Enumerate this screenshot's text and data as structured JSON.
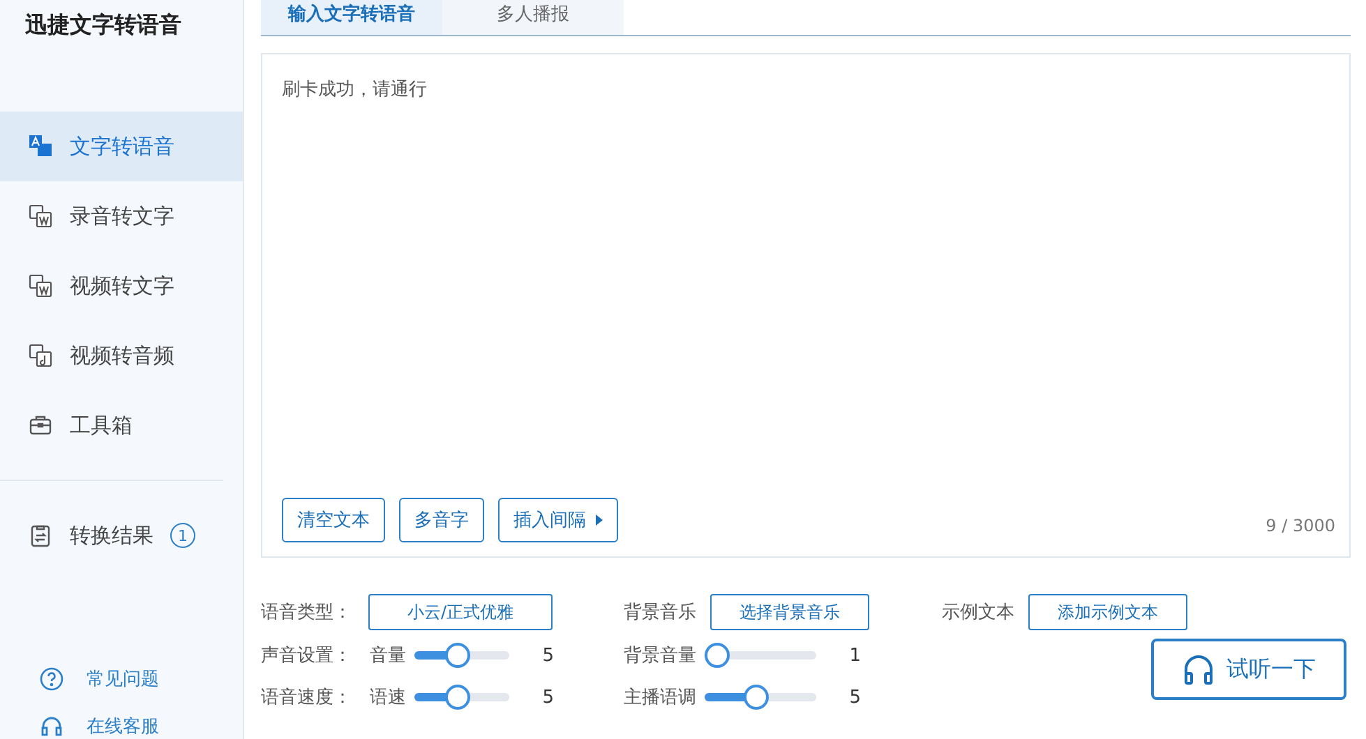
{
  "app": {
    "title": "迅捷文字转语音"
  },
  "sidebar": {
    "items": [
      {
        "label": "文字转语音",
        "selected": true
      },
      {
        "label": "录音转文字",
        "selected": false
      },
      {
        "label": "视频转文字",
        "selected": false
      },
      {
        "label": "视频转音频",
        "selected": false
      },
      {
        "label": "工具箱",
        "selected": false
      }
    ],
    "results": {
      "label": "转换结果",
      "badge": "1"
    },
    "links": [
      {
        "label": "常见问题"
      },
      {
        "label": "在线客服"
      }
    ]
  },
  "tabs": [
    {
      "label": "输入文字转语音",
      "selected": true
    },
    {
      "label": "多人播报",
      "selected": false
    }
  ],
  "editor": {
    "value": "刷卡成功，请通行",
    "buttons": [
      {
        "label": "清空文本",
        "caret": false
      },
      {
        "label": "多音字",
        "caret": false
      },
      {
        "label": "插入间隔",
        "caret": true
      }
    ],
    "counter": "9 / 3000"
  },
  "settings": {
    "row1": [
      {
        "label": "语音类型：",
        "button": "小云/正式优雅"
      },
      {
        "label": "背景音乐",
        "button": "选择背景音乐"
      },
      {
        "label": "示例文本",
        "button": "添加示例文本"
      }
    ],
    "row2": {
      "label": "声音设置：",
      "sliders": [
        {
          "name": "音量",
          "level": 0.45,
          "reading": "5"
        },
        {
          "name": "背景音量",
          "level": 0.0,
          "reading": "1"
        }
      ]
    },
    "row3": {
      "label": "语音速度：",
      "sliders": [
        {
          "name": "语速",
          "level": 0.45,
          "reading": "5"
        },
        {
          "name": "主播语调",
          "level": 0.45,
          "reading": "5"
        }
      ]
    }
  },
  "preview_button": {
    "label": "试听一下"
  }
}
